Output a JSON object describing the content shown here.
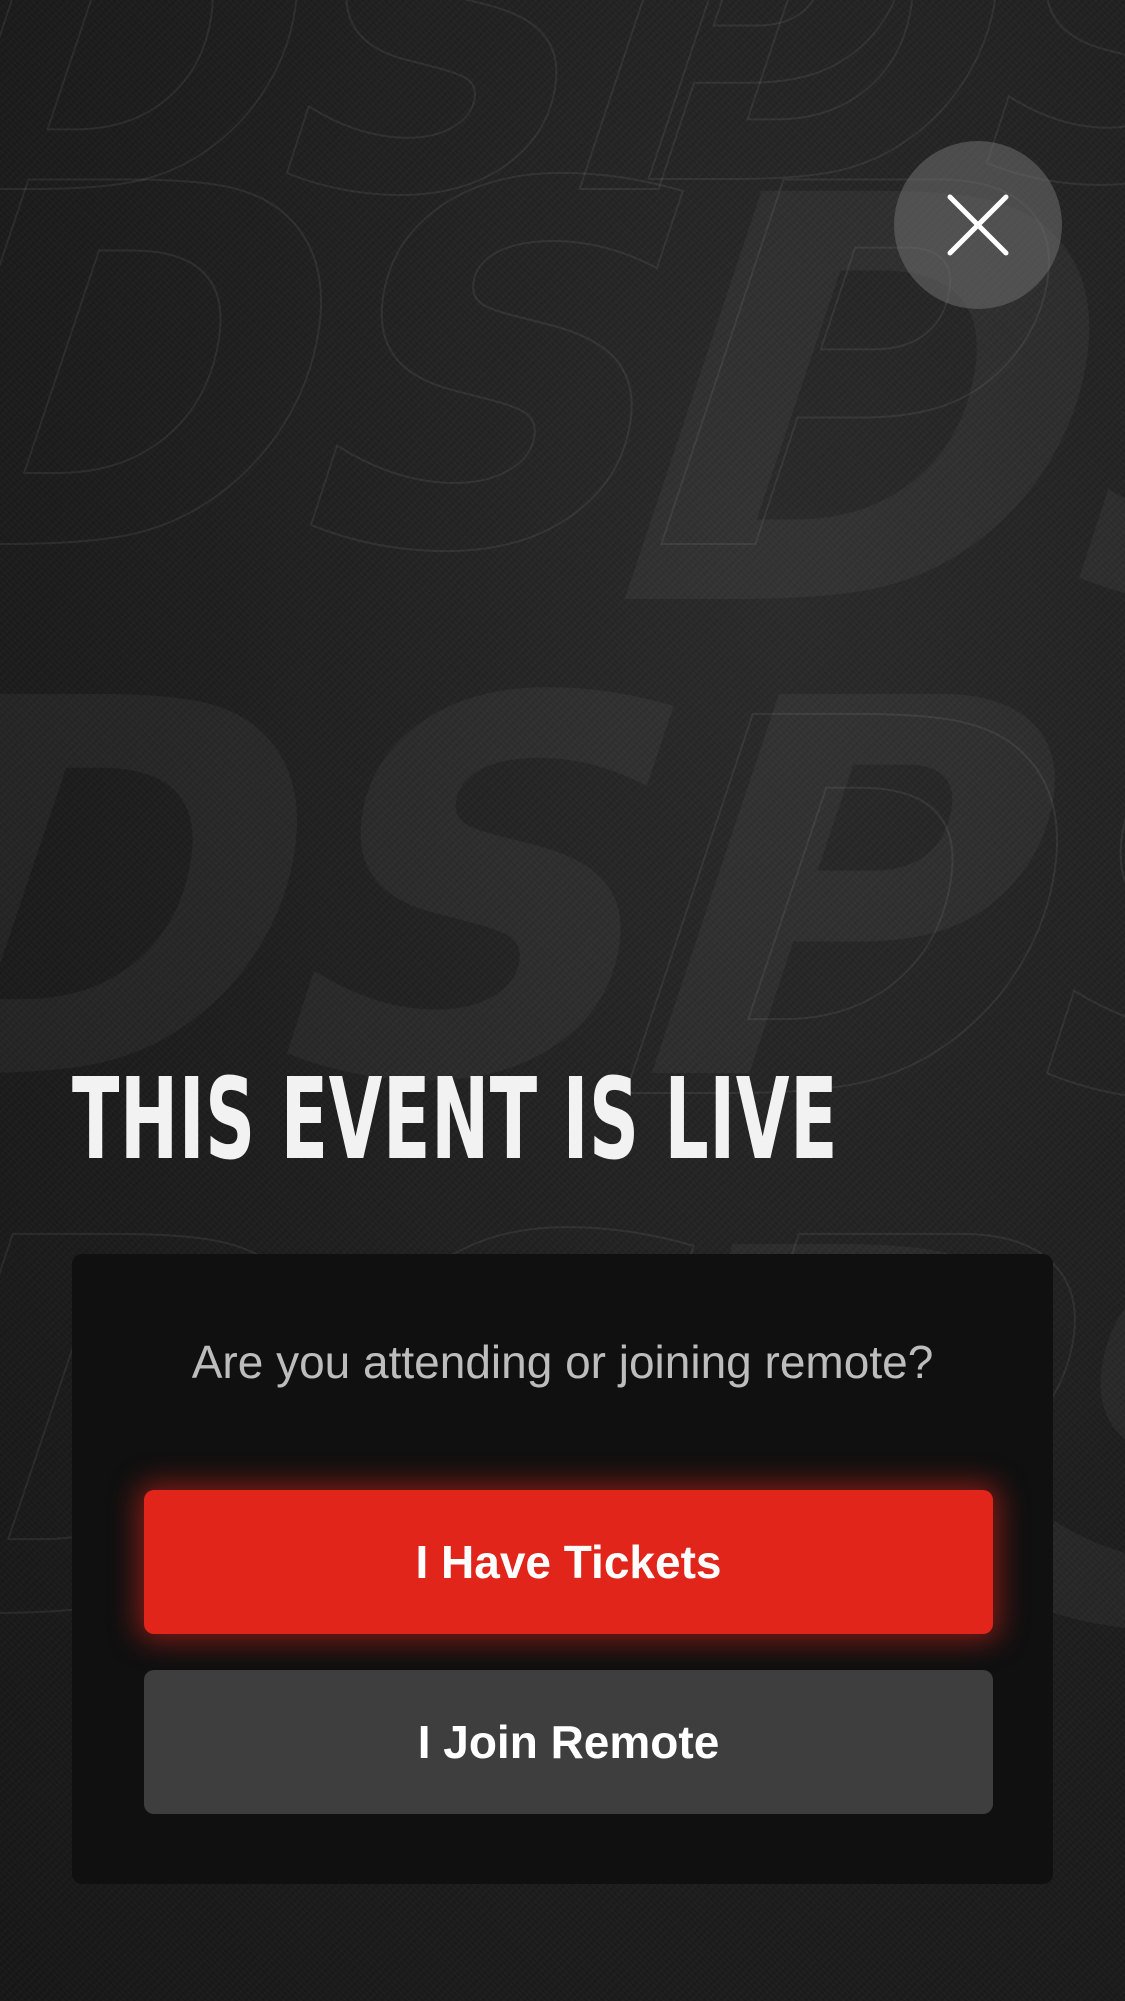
{
  "background": {
    "pattern_text": "DSP"
  },
  "close": {
    "icon": "close-icon"
  },
  "headline": "THIS EVENT IS LIVE",
  "card": {
    "question": "Are you attending or joining remote?",
    "primary_button": "I Have Tickets",
    "secondary_button": "I Join Remote"
  },
  "colors": {
    "accent": "#e1251b",
    "secondary_button": "#3e3e3e",
    "card_background": "#101010"
  }
}
